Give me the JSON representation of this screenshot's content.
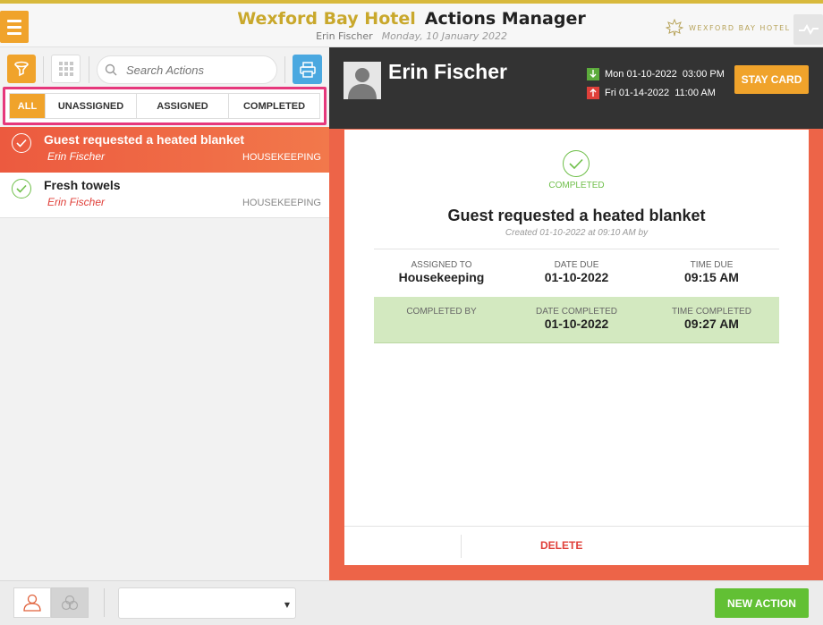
{
  "header": {
    "hotel_name": "Wexford Bay Hotel",
    "app_name": "Actions Manager",
    "user": "Erin Fischer",
    "date": "Monday, 10 January 2022",
    "brand_text": "WEXFORD BAY HOTEL",
    "icons": {
      "menu": "hamburger-icon",
      "brand": "maple-leaf-icon",
      "activity": "pulse-line-icon"
    }
  },
  "toolbar": {
    "search_placeholder": "Search Actions",
    "icons": {
      "filter": "filter-icon",
      "grid": "grid-icon",
      "search": "search-icon",
      "print": "printer-icon"
    }
  },
  "tabs": [
    {
      "label": "ALL",
      "active": true
    },
    {
      "label": "UNASSIGNED",
      "active": false
    },
    {
      "label": "ASSIGNED",
      "active": false
    },
    {
      "label": "COMPLETED",
      "active": false
    }
  ],
  "actions": [
    {
      "title": "Guest requested a heated blanket",
      "guest": "Erin Fischer",
      "department": "HOUSEKEEPING",
      "selected": true
    },
    {
      "title": "Fresh towels",
      "guest": "Erin Fischer",
      "department": "HOUSEKEEPING",
      "selected": false
    }
  ],
  "guest": {
    "name": "Erin Fischer",
    "arrival": "Mon 01-10-2022  03:00 PM",
    "departure": "Fri 01-14-2022  11:00 AM",
    "stay_card_label": "STAY CARD"
  },
  "detail": {
    "status": "COMPLETED",
    "title": "Guest requested a heated blanket",
    "created": "Created 01-10-2022 at 09:10 AM by",
    "row1": [
      {
        "label": "ASSIGNED TO",
        "value": "Housekeeping"
      },
      {
        "label": "DATE DUE",
        "value": "01-10-2022"
      },
      {
        "label": "TIME DUE",
        "value": "09:15 AM"
      }
    ],
    "row2": [
      {
        "label": "COMPLETED BY",
        "value": ""
      },
      {
        "label": "DATE COMPLETED",
        "value": "01-10-2022"
      },
      {
        "label": "TIME COMPLETED",
        "value": "09:27 AM"
      }
    ],
    "delete_label": "DELETE"
  },
  "footer": {
    "new_action_label": "NEW ACTION",
    "icons": {
      "person": "person-icon",
      "group": "group-icon",
      "caret": "caret-down-icon"
    }
  },
  "colors": {
    "accent_orange": "#f0a32b",
    "hotel_gold": "#c9a82c",
    "selected_red": "#ec5a3f",
    "complete_green": "#6fbf4a",
    "highlight_pink": "#e6387c",
    "new_action_green": "#62c034"
  }
}
